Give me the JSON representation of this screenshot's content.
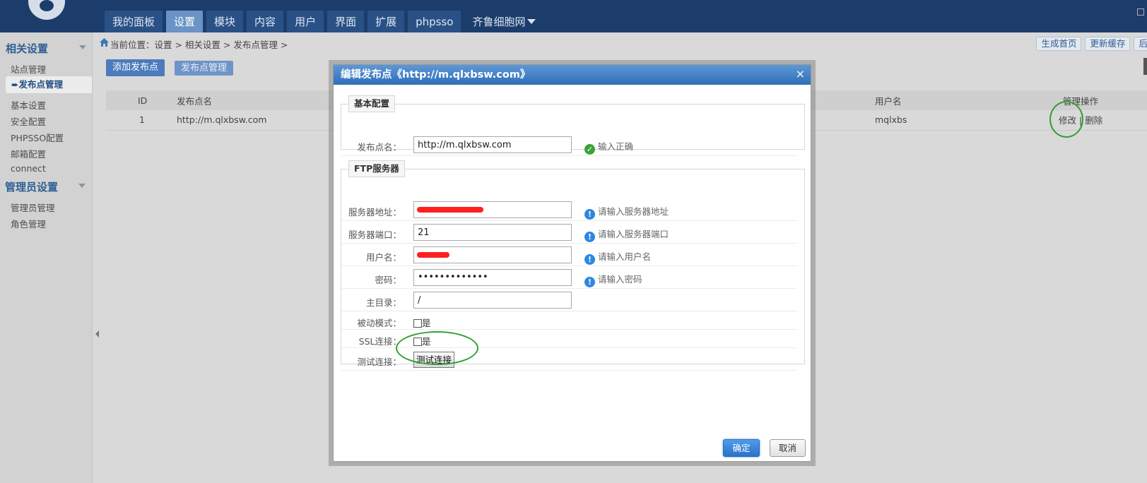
{
  "app": {
    "tabs": [
      {
        "label": "我的面板",
        "active": false
      },
      {
        "label": "设置",
        "active": true
      },
      {
        "label": "模块",
        "active": false
      },
      {
        "label": "内容",
        "active": false
      },
      {
        "label": "用户",
        "active": false
      },
      {
        "label": "界面",
        "active": false
      },
      {
        "label": "扩展",
        "active": false
      },
      {
        "label": "phpsso",
        "active": false
      },
      {
        "label": "齐鲁细胞网",
        "active": false,
        "dropdown": true
      }
    ]
  },
  "sidebar": {
    "section1": "相关设置",
    "items1": [
      "站点管理",
      "发布点管理",
      "基本设置",
      "安全配置",
      "PHPSSO配置",
      "邮箱配置",
      "connect"
    ],
    "active_item": "发布点管理",
    "section2": "管理员设置",
    "items2": [
      "管理员管理",
      "角色管理"
    ]
  },
  "breadcrumb": "当前位置：设置 > 相关设置 > 发布点管理 >",
  "top_buttons": [
    "生成首页",
    "更新缓存",
    "后"
  ],
  "sub_buttons": [
    "添加发布点",
    "发布点管理"
  ],
  "table": {
    "headers": {
      "id": "ID",
      "name": "发布点名",
      "username": "用户名",
      "ops": "管理操作"
    },
    "rows": [
      {
        "id": "1",
        "name": "http://m.qlxbsw.com",
        "username": "mqlxbs",
        "edit": "修改",
        "sep": "|",
        "delete": "删除"
      }
    ]
  },
  "modal": {
    "title": "编辑发布点《http://m.qlxbsw.com》",
    "close": "×",
    "basic": {
      "legend": "基本配置",
      "name_label": "发布点名：",
      "name_value": "http://m.qlxbsw.com",
      "name_hint": "输入正确"
    },
    "ftp": {
      "legend": "FTP服务器",
      "host_label": "服务器地址：",
      "host_hint": "请输入服务器地址",
      "port_label": "服务器端口：",
      "port_value": "21",
      "port_hint": "请输入服务器端口",
      "user_label": "用户名：",
      "user_hint": "请输入用户名",
      "pass_label": "密码：",
      "pass_value": "•••••••••••••",
      "pass_hint": "请输入密码",
      "root_label": "主目录：",
      "root_value": "/",
      "pasv_label": "被动模式：",
      "pasv_text": "是",
      "ssl_label": "SSL连接：",
      "ssl_text": "是",
      "test_label": "测试连接：",
      "test_button": "测试连接"
    },
    "ok": "确定",
    "cancel": "取消"
  },
  "colors": {
    "topbar": "#1c3d6b",
    "accent": "#4b7bbb",
    "annotation_circle": "#2fa12f",
    "redaction": "#ff1f1f"
  }
}
